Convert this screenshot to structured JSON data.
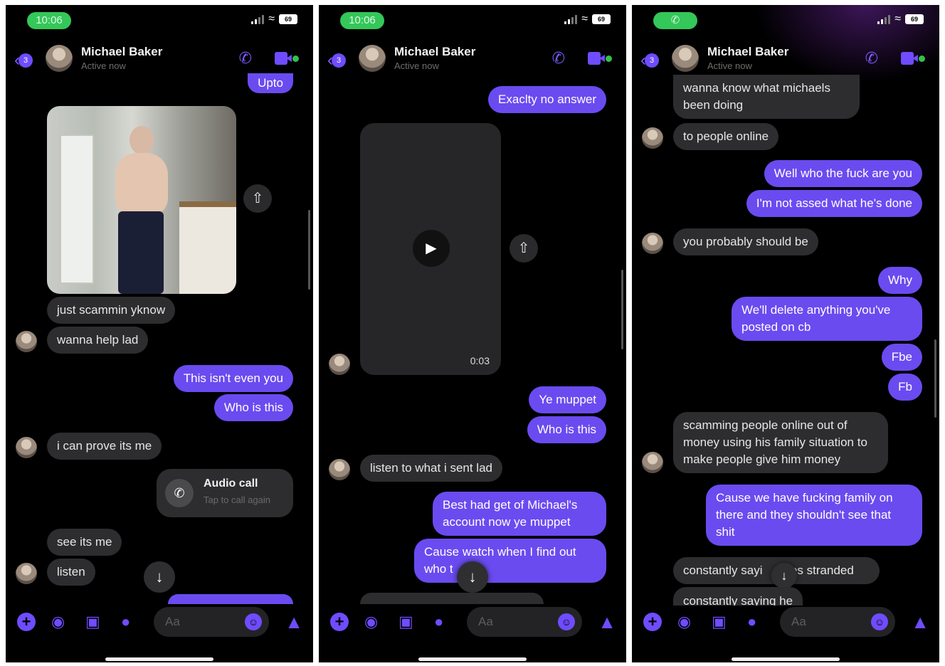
{
  "phones": [
    {
      "status": {
        "time": "10:06",
        "battery": "69"
      },
      "header": {
        "back_count": "3",
        "contact_name": "Michael Baker",
        "presence": "Active now"
      },
      "messages": [
        {
          "text": "Upto",
          "from": "me"
        },
        {
          "text": "just scammin yknow",
          "from": "them"
        },
        {
          "text": "wanna help lad",
          "from": "them"
        },
        {
          "text": "This isn't even you",
          "from": "me"
        },
        {
          "text": "Who is this",
          "from": "me"
        },
        {
          "text": "i can prove its me",
          "from": "them"
        },
        {
          "text": "see its me",
          "from": "them"
        },
        {
          "text": "listen",
          "from": "them"
        }
      ],
      "call_card": {
        "title": "Audio call",
        "subtitle": "Tap to call again"
      },
      "composer": {
        "placeholder": "Aa"
      }
    },
    {
      "status": {
        "time": "10:06",
        "battery": "69"
      },
      "header": {
        "back_count": "3",
        "contact_name": "Michael Baker",
        "presence": "Active now"
      },
      "messages": [
        {
          "text": "Exaclty no answer",
          "from": "me"
        },
        {
          "text": "Ye muppet",
          "from": "me"
        },
        {
          "text": "Who is this",
          "from": "me"
        },
        {
          "text": "listen to what i sent lad",
          "from": "them"
        },
        {
          "text": "Best had get of Michael's account now ye muppet",
          "from": "me"
        },
        {
          "text": "Cause watch when I find out who t",
          "from": "me"
        }
      ],
      "video": {
        "duration": "0:03"
      },
      "composer": {
        "placeholder": "Aa"
      }
    },
    {
      "status": {
        "battery": "69"
      },
      "header": {
        "back_count": "3",
        "contact_name": "Michael Baker",
        "presence": "Active now"
      },
      "messages": [
        {
          "text": "wanna know what michaels been doing",
          "from": "them"
        },
        {
          "text": "to people online",
          "from": "them"
        },
        {
          "text": "Well who the fuck are you",
          "from": "me"
        },
        {
          "text": "I'm not assed what he's done",
          "from": "me"
        },
        {
          "text": "you probably should be",
          "from": "them"
        },
        {
          "text": "Why",
          "from": "me"
        },
        {
          "text": "We'll delete anything you've posted on cb",
          "from": "me"
        },
        {
          "text": "Fbe",
          "from": "me"
        },
        {
          "text": "Fb",
          "from": "me"
        },
        {
          "text": "scamming people online out of money using his family situation to make people give him money",
          "from": "them"
        },
        {
          "text": "Cause we have fucking family on there and they shouldn't see that shit",
          "from": "me"
        },
        {
          "text": "constantly sayi",
          "from": "them"
        },
        {
          "text": "es stranded",
          "from": "them"
        },
        {
          "text": "constantly saying he",
          "from": "them"
        }
      ],
      "composer": {
        "placeholder": "Aa"
      }
    }
  ],
  "icons": {
    "back": "chevron-left-icon",
    "call": "phone-icon",
    "video": "video-camera-icon",
    "share": "share-icon",
    "scroll_down": "arrow-down-icon",
    "play": "play-icon",
    "plus": "plus-icon",
    "camera": "camera-icon",
    "gallery": "image-icon",
    "mic": "microphone-icon",
    "emoji": "emoji-icon",
    "like": "thumbs-up-icon"
  },
  "colors": {
    "accent": "#6a4bf0",
    "incoming_bubble": "#2d2d2f",
    "background": "#000000",
    "status_pill": "#34c759"
  }
}
